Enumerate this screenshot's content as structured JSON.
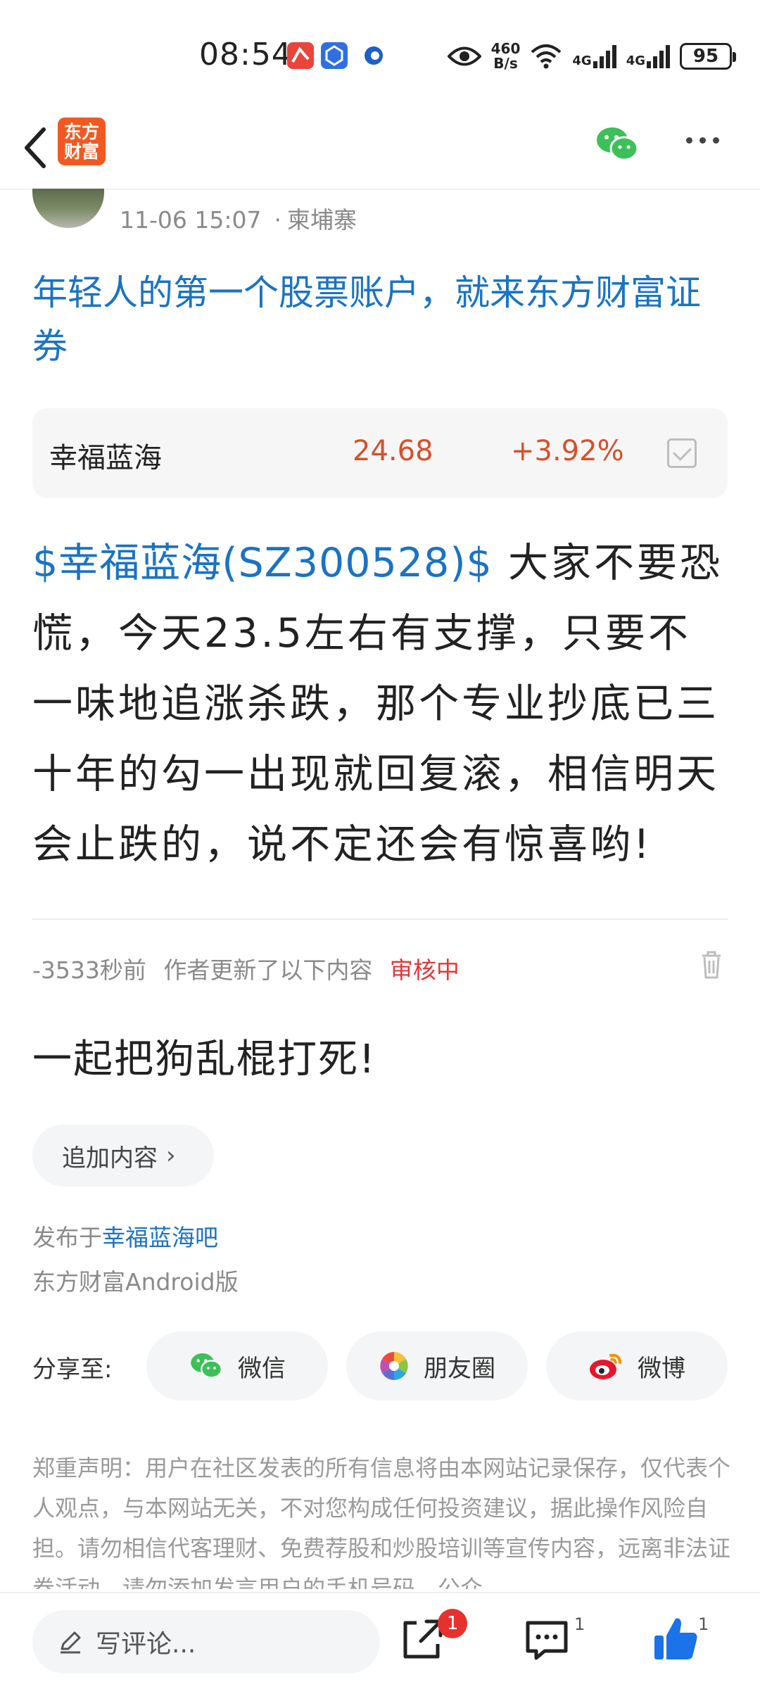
{
  "status_bar": {
    "time": "08:54",
    "net_speed_value": "460",
    "net_speed_unit": "B/s",
    "net1": "4G",
    "net2": "4G",
    "battery": "95"
  },
  "nav": {
    "logo_line1": "东方",
    "logo_line2": "财富"
  },
  "author": {
    "timestamp": "11-06 15:07",
    "location": "柬埔寨"
  },
  "post": {
    "title": "年轻人的第一个股票账户，就来东方财富证券",
    "stock_card": {
      "name": "幸福蓝海",
      "price": "24.68",
      "change": "+3.92%"
    },
    "body_stock_link": "$幸福蓝海(SZ300528)$",
    "body_text": "大家不要恐慌，今天23.5左右有支撑，只要不一味地追涨杀跌，那个专业抄底已三十年的勾一出现就回复滚，相信明天会止跌的，说不定还会有惊喜哟!",
    "update_time": "-3533秒前",
    "update_note": "作者更新了以下内容",
    "update_status": "审核中",
    "update_text": "一起把狗乱棍打死!",
    "add_content_label": "追加内容",
    "published_prefix": "发布于",
    "published_bar": "幸福蓝海吧",
    "platform": "东方财富Android版"
  },
  "share": {
    "label": "分享至:",
    "wechat": "微信",
    "moments": "朋友圈",
    "weibo": "微博"
  },
  "disclaimer": "郑重声明：用户在社区发表的所有信息将由本网站记录保存，仅代表个人观点，与本网站无关，不对您构成任何投资建议，据此操作风险自担。请勿相信代客理财、免费荐股和炒股培训等宣传内容，远离非法证券活动。请勿添加发言用户的手机号码、公众",
  "bottom_bar": {
    "comment_placeholder": "写评论...",
    "share_badge": "1",
    "comment_count": "1",
    "like_count": "1"
  }
}
